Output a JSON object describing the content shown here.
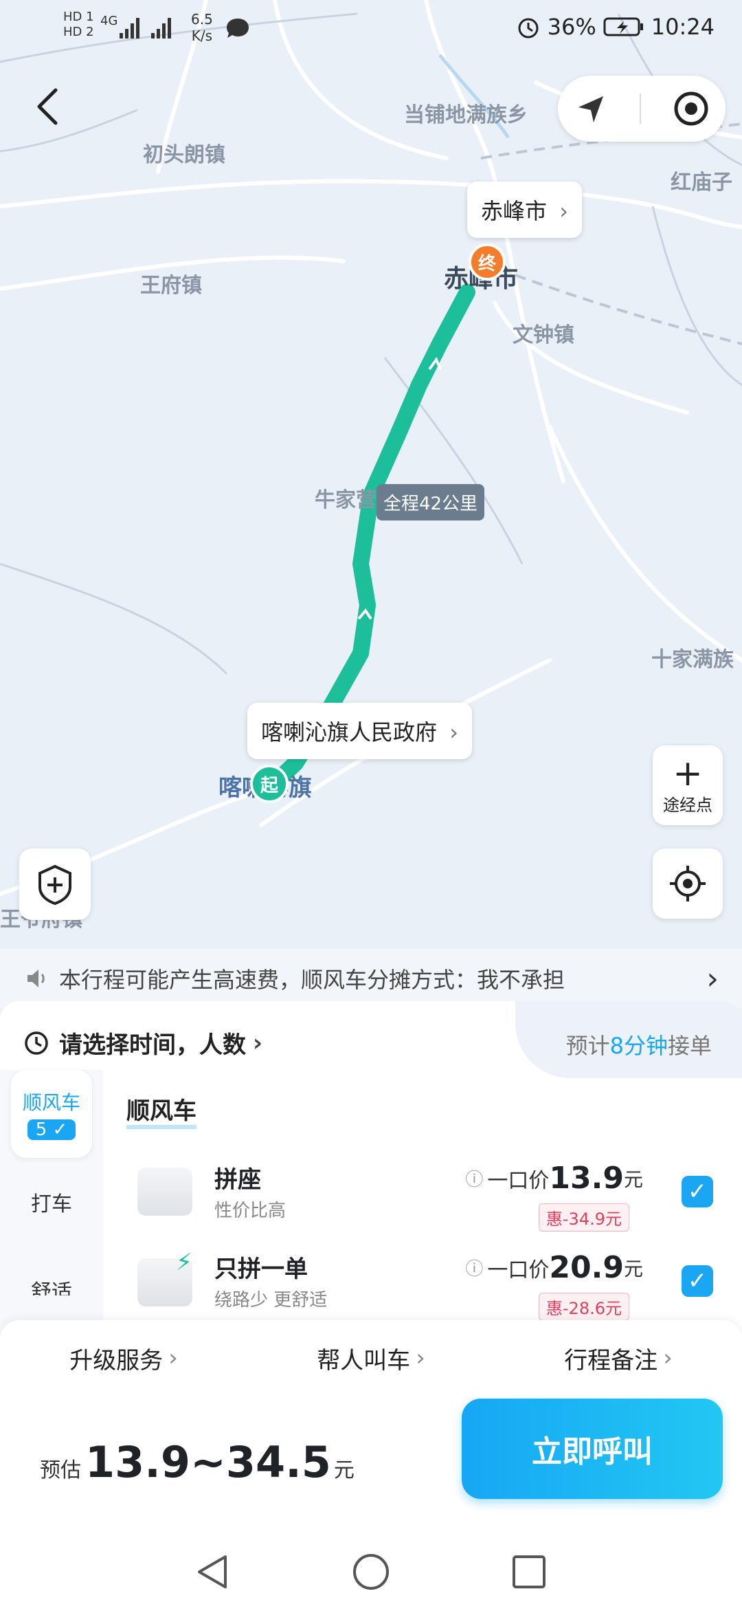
{
  "status": {
    "hd1": "HD 1",
    "hd2": "HD 2",
    "net": "4G",
    "speed_value": "6.5",
    "speed_unit": "K/s",
    "battery": "36%",
    "time": "10:24"
  },
  "map": {
    "places": {
      "dangpu": "当铺地满族乡",
      "chutoulang": "初头朗镇",
      "hongmiaozi": "红庙子",
      "wangfu": "王府镇",
      "chifeng": "赤峰市",
      "wenzhong": "文钟镇",
      "niujiaying": "牛家营子镇",
      "shijiaman": "十家满族",
      "kalaqinqi": "喀喇沁旗",
      "wangyefu": "王爷府镇"
    },
    "end_bubble": "赤峰市",
    "start_bubble": "喀喇沁旗人民政府",
    "distance": "全程42公里",
    "end_marker": "终",
    "start_marker": "起",
    "waypoint_label": "途经点"
  },
  "notice": {
    "text": "本行程可能产生高速费，顺风车分摊方式：我不承担"
  },
  "panel": {
    "select_time": "请选择时间，人数",
    "eta_prefix": "预计",
    "eta_value": "8分钟",
    "eta_suffix": "接单",
    "side": {
      "tab1": "顺风车",
      "tab1_count": "5",
      "tab2": "打车",
      "tab3": "舒适"
    },
    "section_title": "顺风车",
    "options": [
      {
        "name": "拼座",
        "desc": "性价比高",
        "price_label": "一口价",
        "price": "13.9",
        "unit": "元",
        "discount": "惠-34.9元"
      },
      {
        "name": "只拼一单",
        "desc": "绕路少 更舒适",
        "price_label": "一口价",
        "price": "20.9",
        "unit": "元",
        "discount": "惠-28.6元"
      }
    ]
  },
  "options_bar": {
    "upgrade": "升级服务",
    "help_call": "帮人叫车",
    "note": "行程备注"
  },
  "bottom": {
    "estimate_label": "预估",
    "estimate_value": "13.9~34.5",
    "estimate_unit": "元",
    "call_button": "立即呼叫"
  },
  "colors": {
    "route": "#1dbf9a",
    "accent": "#1aa6f2",
    "end_marker": "#f57c2a",
    "discount": "#e0405c"
  }
}
